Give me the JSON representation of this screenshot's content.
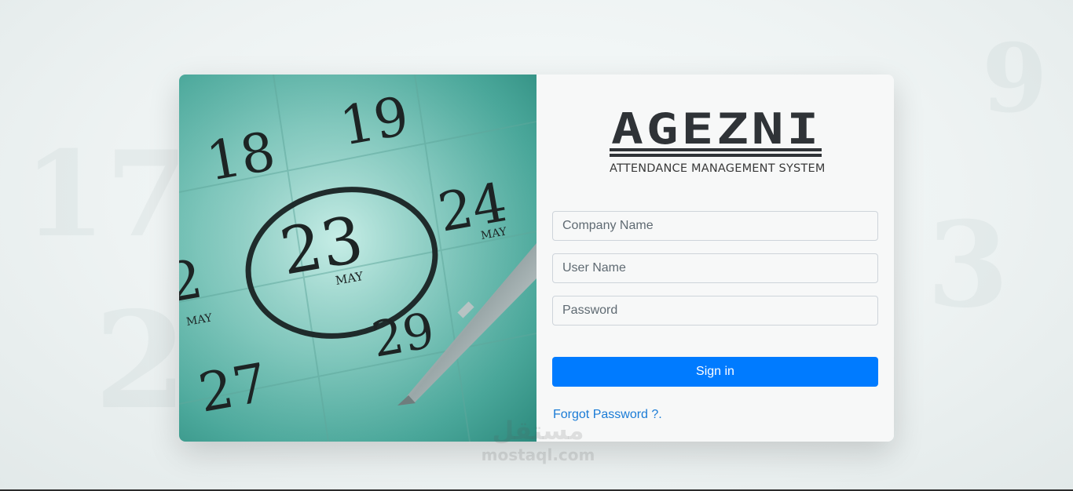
{
  "logo": {
    "brand": "AGEZNI",
    "tagline": "ATTENDANCE MANAGEMENT SYSTEM"
  },
  "photo": {
    "dates": [
      "18",
      "19",
      "23",
      "24",
      "29",
      "27",
      "2"
    ],
    "month": "MAY",
    "description_icon": "calendar-pen-image"
  },
  "form": {
    "company": {
      "placeholder": "Company Name",
      "value": ""
    },
    "username": {
      "placeholder": "User Name",
      "value": ""
    },
    "password": {
      "placeholder": "Password",
      "value": ""
    },
    "signin_label": "Sign in",
    "forgot_label": "Forgot Password ?."
  },
  "watermark": {
    "arabic": "مستقل",
    "latin": "mostaql.com"
  },
  "colors": {
    "primary": "#007bff",
    "link": "#1a7bd6",
    "panel": "#f7f8f8",
    "logo_dark": "#2f3337"
  }
}
